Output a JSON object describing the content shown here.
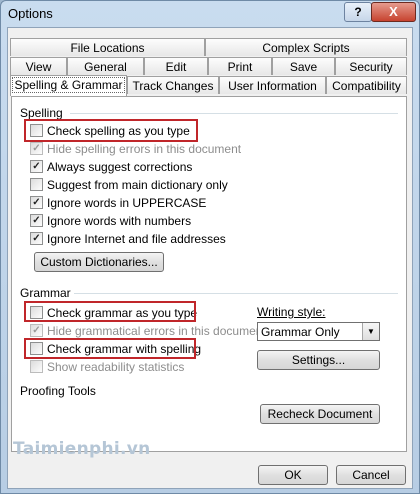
{
  "window": {
    "title": "Options",
    "help_label": "?",
    "close_label": "X"
  },
  "tabs": {
    "row1": [
      "File Locations",
      "Complex Scripts"
    ],
    "row2": [
      "View",
      "General",
      "Edit",
      "Print",
      "Save",
      "Security"
    ],
    "row3": [
      "Spelling & Grammar",
      "Track Changes",
      "User Information",
      "Compatibility"
    ],
    "selected": "Spelling & Grammar"
  },
  "spelling": {
    "header": "Spelling",
    "options": [
      {
        "label": "Check spelling as you type",
        "checked": false,
        "enabled": true
      },
      {
        "label": "Hide spelling errors in this document",
        "checked": true,
        "enabled": false
      },
      {
        "label": "Always suggest corrections",
        "checked": true,
        "enabled": true
      },
      {
        "label": "Suggest from main dictionary only",
        "checked": false,
        "enabled": true
      },
      {
        "label": "Ignore words in UPPERCASE",
        "checked": true,
        "enabled": true
      },
      {
        "label": "Ignore words with numbers",
        "checked": true,
        "enabled": true
      },
      {
        "label": "Ignore Internet and file addresses",
        "checked": true,
        "enabled": true
      }
    ],
    "custom_dictionaries_label": "Custom Dictionaries..."
  },
  "grammar": {
    "header": "Grammar",
    "options": [
      {
        "label": "Check grammar as you type",
        "checked": false,
        "enabled": true
      },
      {
        "label": "Hide grammatical errors in this document",
        "checked": true,
        "enabled": false
      },
      {
        "label": "Check grammar with spelling",
        "checked": false,
        "enabled": true
      },
      {
        "label": "Show readability statistics",
        "checked": false,
        "enabled": false
      }
    ],
    "writing_style_label": "Writing style:",
    "writing_style_value": "Grammar Only",
    "settings_label": "Settings..."
  },
  "proofing": {
    "header": "Proofing Tools",
    "recheck_label": "Recheck Document"
  },
  "footer": {
    "ok_label": "OK",
    "cancel_label": "Cancel"
  },
  "watermark": "Taimienphi.vn",
  "colors": {
    "highlight": "#c0262a",
    "title_bar": "#c9dcef",
    "close_button": "#c7432f"
  }
}
